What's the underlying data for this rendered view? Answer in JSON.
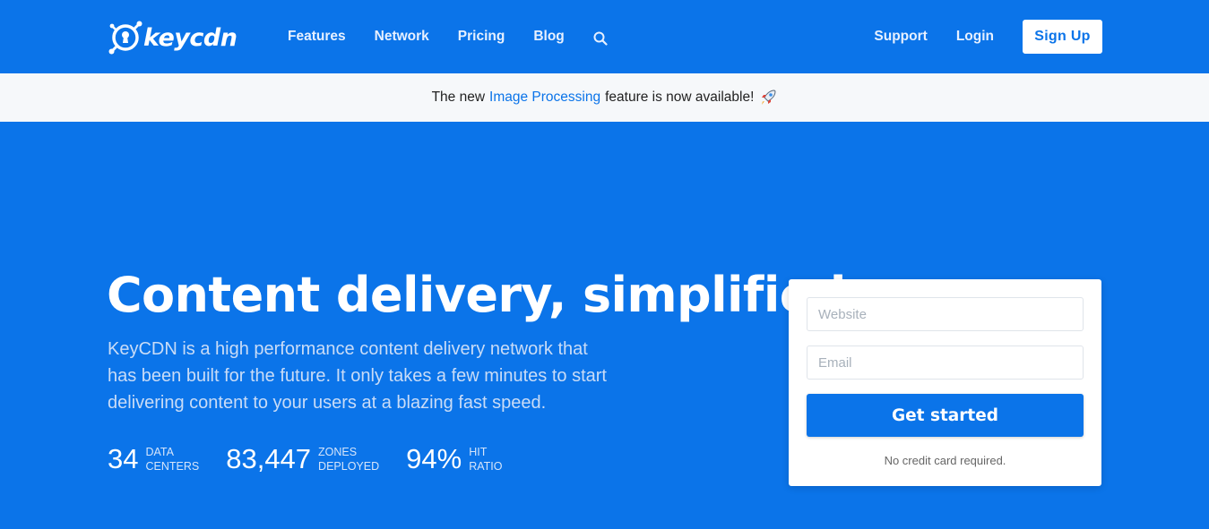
{
  "brand": {
    "name": "keycdn",
    "accent": "#0b74e9"
  },
  "nav": {
    "links": [
      "Features",
      "Network",
      "Pricing",
      "Blog"
    ],
    "search_icon": "search-icon",
    "support": "Support",
    "login": "Login",
    "signup": "Sign Up"
  },
  "announcement": {
    "before": "The new",
    "link": "Image Processing",
    "after": "feature is now available!",
    "icon": "rocket-icon"
  },
  "hero": {
    "title": "Content delivery, simplified.",
    "description": "KeyCDN is a high performance content delivery network that has been built for the future. It only takes a few minutes to start delivering content to your users at a blazing fast speed.",
    "stats": [
      {
        "value": "34",
        "label_line1": "DATA",
        "label_line2": "CENTERS"
      },
      {
        "value": "83,447",
        "label_line1": "ZONES",
        "label_line2": "DEPLOYED"
      },
      {
        "value": "94%",
        "label_line1": "HIT",
        "label_line2": "RATIO"
      }
    ]
  },
  "signup_form": {
    "website_placeholder": "Website",
    "email_placeholder": "Email",
    "submit_label": "Get started",
    "note": "No credit card required."
  }
}
